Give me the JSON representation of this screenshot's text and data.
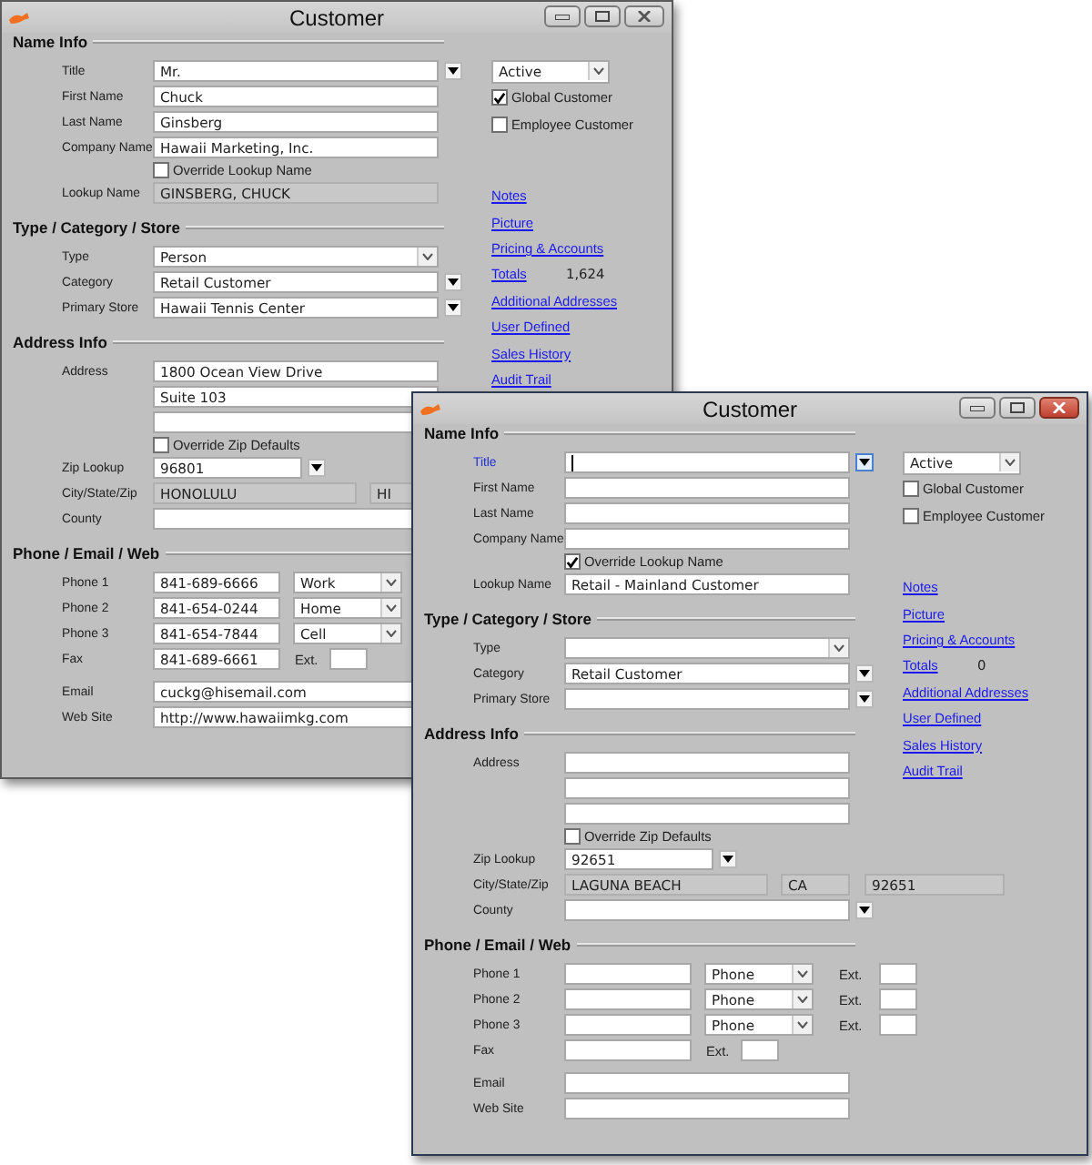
{
  "windows": [
    {
      "title": "Customer",
      "active": false,
      "sections": [
        {
          "heading": "Name Info",
          "rows": [
            {
              "kind": "combo",
              "label": "Title",
              "value": "Mr.",
              "focused": false
            },
            {
              "kind": "text",
              "label": "First Name",
              "value": "Chuck"
            },
            {
              "kind": "text",
              "label": "Last Name",
              "value": "Ginsberg"
            },
            {
              "kind": "text",
              "label": "Company Name",
              "value": "Hawaii Marketing, Inc."
            },
            {
              "kind": "check",
              "label": "Override Lookup Name",
              "checked": false
            },
            {
              "kind": "text",
              "label": "Lookup Name",
              "value": "GINSBERG, CHUCK",
              "readonly": true
            }
          ]
        },
        {
          "heading": "Type / Category / Store",
          "rows": [
            {
              "kind": "dropdown",
              "label": "Type",
              "value": "Person"
            },
            {
              "kind": "combo",
              "label": "Category",
              "value": "Retail Customer"
            },
            {
              "kind": "combo",
              "label": "Primary Store",
              "value": "Hawaii Tennis Center"
            }
          ]
        },
        {
          "heading": "Address Info",
          "rows": [
            {
              "kind": "text",
              "label": "Address",
              "value": "1800 Ocean View Drive"
            },
            {
              "kind": "text",
              "value": "Suite 103"
            },
            {
              "kind": "text"
            },
            {
              "kind": "check",
              "label": "Override Zip Defaults",
              "checked": false
            },
            {
              "kind": "zip",
              "label": "Zip Lookup",
              "value": "96801"
            },
            {
              "kind": "csz",
              "label": "City/State/Zip",
              "parts": [
                "HONOLULU",
                "HI"
              ]
            },
            {
              "kind": "text",
              "label": "County"
            }
          ]
        },
        {
          "heading": "Phone / Email / Web",
          "rows": [
            {
              "kind": "phone",
              "label": "Phone 1",
              "value": "841-689-6666",
              "type": "Work"
            },
            {
              "kind": "phone",
              "label": "Phone 2",
              "value": "841-654-0244",
              "type": "Home"
            },
            {
              "kind": "phone",
              "label": "Phone 3",
              "value": "841-654-7844",
              "type": "Cell"
            },
            {
              "kind": "fax",
              "label": "Fax",
              "value": "841-689-6661",
              "ext_label": "Ext."
            },
            {
              "kind": "text",
              "label": "Email",
              "value": "cuckg@hisemail.com"
            },
            {
              "kind": "text",
              "label": "Web Site",
              "value": "http://www.hawaiimkg.com"
            }
          ]
        }
      ],
      "status": "Active",
      "options": [
        {
          "label": "Global Customer",
          "checked": true
        },
        {
          "label": "Employee Customer",
          "checked": false
        }
      ],
      "links": [
        {
          "label": "Notes"
        },
        {
          "label": "Picture"
        },
        {
          "label": "Pricing & Accounts"
        },
        {
          "label": "Totals",
          "value": "1,624"
        },
        {
          "label": "Additional Addresses"
        },
        {
          "label": "User Defined"
        },
        {
          "label": "Sales History"
        },
        {
          "label": "Audit Trail"
        }
      ]
    },
    {
      "title": "Customer",
      "active": true,
      "sections": [
        {
          "heading": "Name Info",
          "rows": [
            {
              "kind": "combo",
              "label": "Title",
              "focused": true
            },
            {
              "kind": "text",
              "label": "First Name"
            },
            {
              "kind": "text",
              "label": "Last Name"
            },
            {
              "kind": "text",
              "label": "Company Name"
            },
            {
              "kind": "check",
              "label": "Override Lookup Name",
              "checked": true
            },
            {
              "kind": "text",
              "label": "Lookup Name",
              "value": "Retail - Mainland Customer",
              "readonly": false
            }
          ]
        },
        {
          "heading": "Type / Category / Store",
          "rows": [
            {
              "kind": "dropdown",
              "label": "Type"
            },
            {
              "kind": "combo",
              "label": "Category",
              "value": "Retail Customer"
            },
            {
              "kind": "combo",
              "label": "Primary Store"
            }
          ]
        },
        {
          "heading": "Address Info",
          "rows": [
            {
              "kind": "text",
              "label": "Address"
            },
            {
              "kind": "text"
            },
            {
              "kind": "text"
            },
            {
              "kind": "check",
              "label": "Override Zip Defaults",
              "checked": false
            },
            {
              "kind": "zip",
              "label": "Zip Lookup",
              "value": "92651"
            },
            {
              "kind": "csz",
              "label": "City/State/Zip",
              "parts": [
                "LAGUNA BEACH",
                "CA",
                "92651"
              ]
            },
            {
              "kind": "combo",
              "label": "County"
            }
          ]
        },
        {
          "heading": "Phone / Email / Web",
          "rows": [
            {
              "kind": "phone",
              "label": "Phone 1",
              "type": "Phone",
              "ext_label": "Ext."
            },
            {
              "kind": "phone",
              "label": "Phone 2",
              "type": "Phone",
              "ext_label": "Ext."
            },
            {
              "kind": "phone",
              "label": "Phone 3",
              "type": "Phone",
              "ext_label": "Ext."
            },
            {
              "kind": "fax",
              "label": "Fax",
              "ext_label": "Ext."
            },
            {
              "kind": "text",
              "label": "Email"
            },
            {
              "kind": "text",
              "label": "Web Site"
            }
          ]
        }
      ],
      "status": "Active",
      "options": [
        {
          "label": "Global Customer",
          "checked": false
        },
        {
          "label": "Employee Customer",
          "checked": false
        }
      ],
      "links": [
        {
          "label": "Notes"
        },
        {
          "label": "Picture"
        },
        {
          "label": "Pricing & Accounts"
        },
        {
          "label": "Totals",
          "value": "0"
        },
        {
          "label": "Additional Addresses"
        },
        {
          "label": "User Defined"
        },
        {
          "label": "Sales History"
        },
        {
          "label": "Audit Trail"
        }
      ]
    }
  ]
}
